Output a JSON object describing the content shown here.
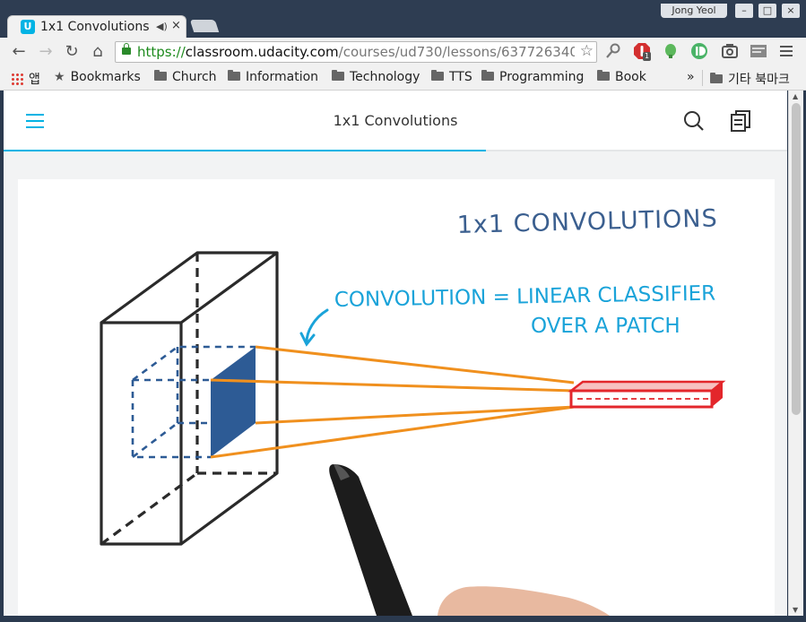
{
  "browser": {
    "profile_name": "Jong Yeol",
    "window_controls": {
      "minimize": "–",
      "maximize": "□",
      "close": "×"
    },
    "tab": {
      "title": "1x1 Convolutions",
      "favicon_letter": "U",
      "speaker_icon": "◀)",
      "close_icon": "×"
    },
    "url": {
      "scheme": "https://",
      "host": "classroom.udacity.com",
      "path": "/courses/ud730/lessons/6377263405/c"
    },
    "extension_badge": "1",
    "bookmarks": {
      "apps_label": "앱",
      "items": [
        "Bookmarks",
        "Church",
        "Information",
        "Technology",
        "TTS",
        "Programming",
        "Book"
      ],
      "overflow": "»",
      "other_bookmarks": "기타 북마크"
    }
  },
  "page": {
    "title": "1x1 Convolutions",
    "progress_fraction": 0.615,
    "video": {
      "heading": "1x1 CONVOLUTIONS",
      "annotation_line1": "CONVOLUTION = LINEAR CLASSIFIER",
      "annotation_line2": "OVER A PATCH"
    }
  },
  "colors": {
    "accent": "#02b3e4",
    "heading_ink": "#3b5f8f",
    "annotation_ink": "#1aa3d9",
    "patch_fill": "#2d5b95",
    "projection_lines": "#f0901e",
    "output_cell": "#e3262b"
  }
}
